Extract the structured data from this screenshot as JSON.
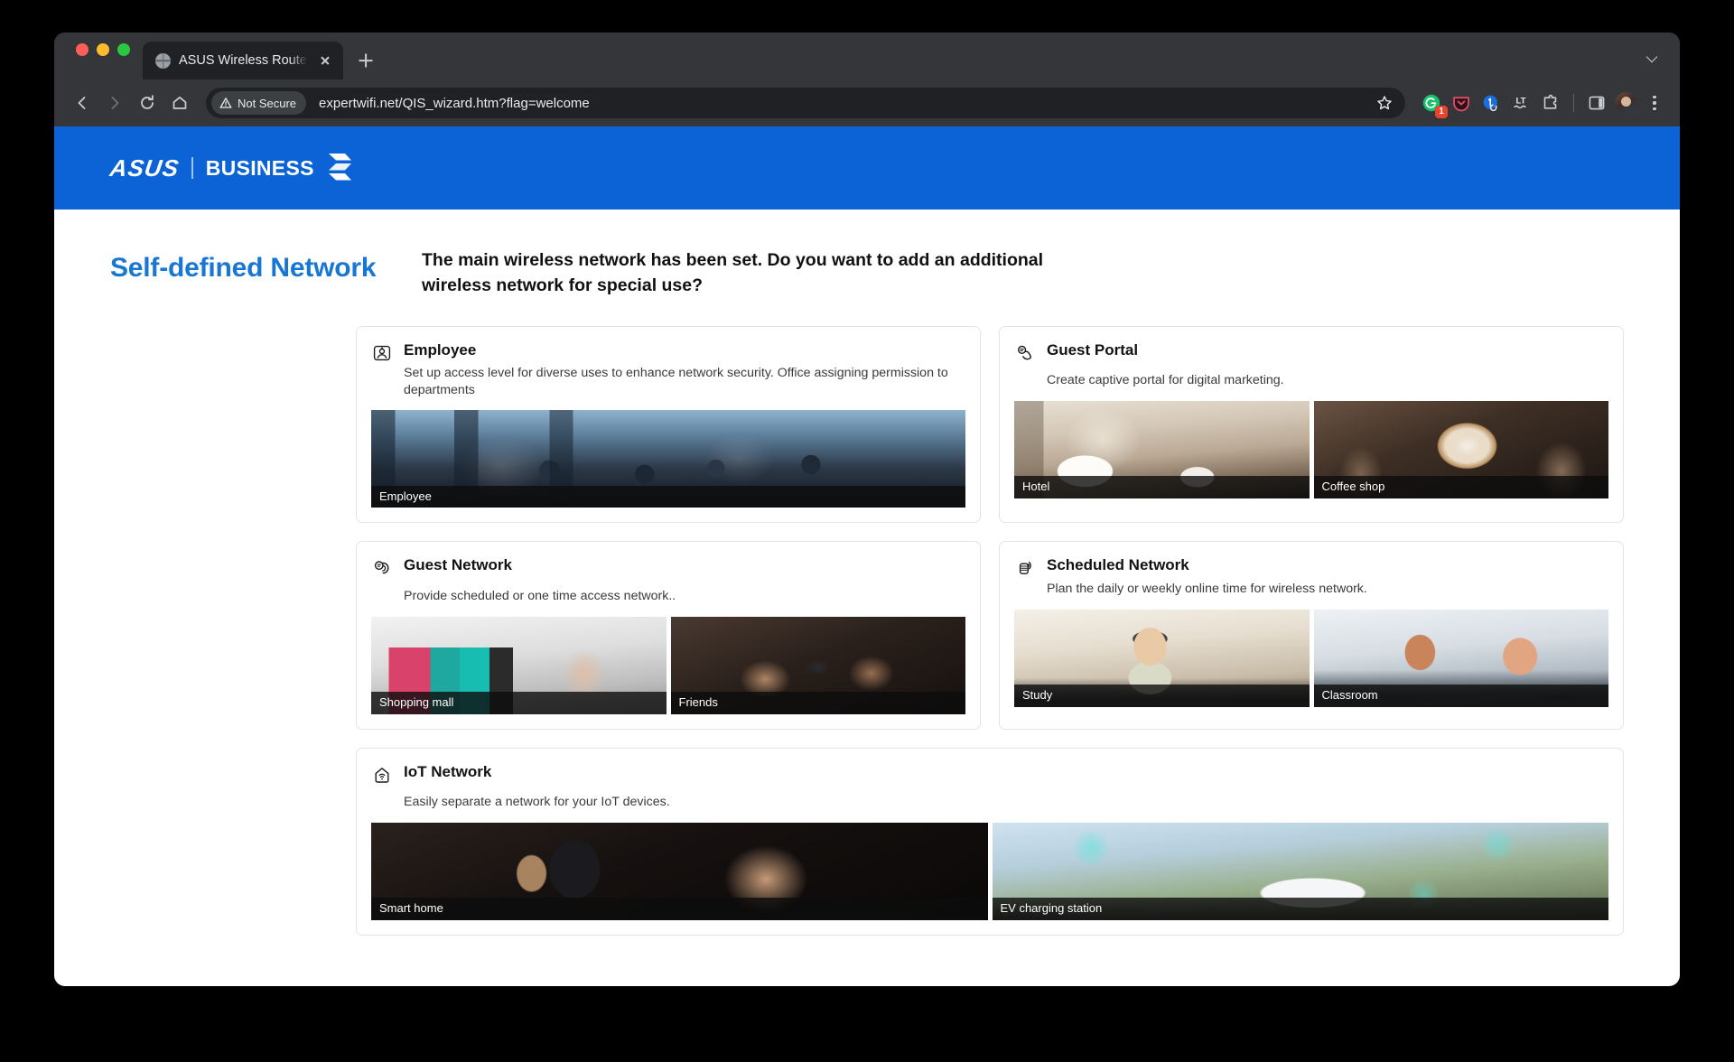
{
  "browser": {
    "tab": {
      "title": "ASUS Wireless Router Exper",
      "favicon_icon": "globe-icon",
      "close_icon": "close-icon"
    },
    "new_tab_icon": "plus-icon",
    "tab_list_icon": "chevron-down-icon",
    "nav": {
      "back_icon": "arrow-left-icon",
      "forward_icon": "arrow-right-icon",
      "reload_icon": "reload-icon",
      "home_icon": "home-icon"
    },
    "omnibox": {
      "security_icon": "warning-triangle-icon",
      "security_label": "Not Secure",
      "url": "expertwifi.net/QIS_wizard.htm?flag=welcome",
      "bookmark_icon": "star-icon"
    },
    "extensions": [
      {
        "name": "grammarly-extension-icon",
        "badge": "1"
      },
      {
        "name": "pocket-extension-icon",
        "badge": ""
      },
      {
        "name": "onepassword-extension-icon",
        "badge": ""
      },
      {
        "name": "languagetool-extension-icon",
        "label": "LT",
        "badge": ""
      },
      {
        "name": "extensions-puzzle-icon",
        "badge": ""
      }
    ],
    "side_panel_icon": "side-panel-icon",
    "profile_icon": "avatar",
    "menu_icon": "kebab-menu-icon"
  },
  "header": {
    "brand": "ASUS",
    "product": "BUSINESS",
    "brand_color": "#0b63d6",
    "mark_icon": "expert-wifi-chevron-icon"
  },
  "page": {
    "title": "Self-defined Network",
    "title_color": "#1877d2",
    "question": "The main wireless network has been set. Do you want to add an additional wireless network for special use?"
  },
  "cards": [
    {
      "id": "employee",
      "icon": "id-badge-person-icon",
      "title": "Employee",
      "description": "Set up access level for diverse uses to enhance network security. Office assigning permission to departments",
      "thumbs": [
        {
          "caption": "Employee",
          "photo": "ph-office"
        }
      ]
    },
    {
      "id": "guest-portal",
      "icon": "hand-tap-icon",
      "title": "Guest Portal",
      "description": "Create captive portal for digital marketing.",
      "thumbs": [
        {
          "caption": "Hotel",
          "photo": "ph-hotel"
        },
        {
          "caption": "Coffee shop",
          "photo": "ph-coffee"
        }
      ]
    },
    {
      "id": "guest-network",
      "icon": "wifi-guest-icon",
      "title": "Guest Network",
      "description": "Provide scheduled or one time access network..",
      "thumbs": [
        {
          "caption": "Shopping mall",
          "photo": "ph-mall"
        },
        {
          "caption": "Friends",
          "photo": "ph-friends"
        }
      ]
    },
    {
      "id": "scheduled-network",
      "icon": "clock-wifi-icon",
      "title": "Scheduled Network",
      "description": "Plan the daily or weekly online time for wireless network.",
      "thumbs": [
        {
          "caption": "Study",
          "photo": "ph-study"
        },
        {
          "caption": "Classroom",
          "photo": "ph-class"
        }
      ]
    },
    {
      "id": "iot-network",
      "icon": "house-wifi-icon",
      "title": "IoT Network",
      "description": "Easily separate a network for your IoT devices.",
      "thumbs": [
        {
          "caption": "Smart home",
          "photo": "ph-smarthome"
        },
        {
          "caption": "EV charging station",
          "photo": "ph-ev"
        }
      ]
    }
  ]
}
